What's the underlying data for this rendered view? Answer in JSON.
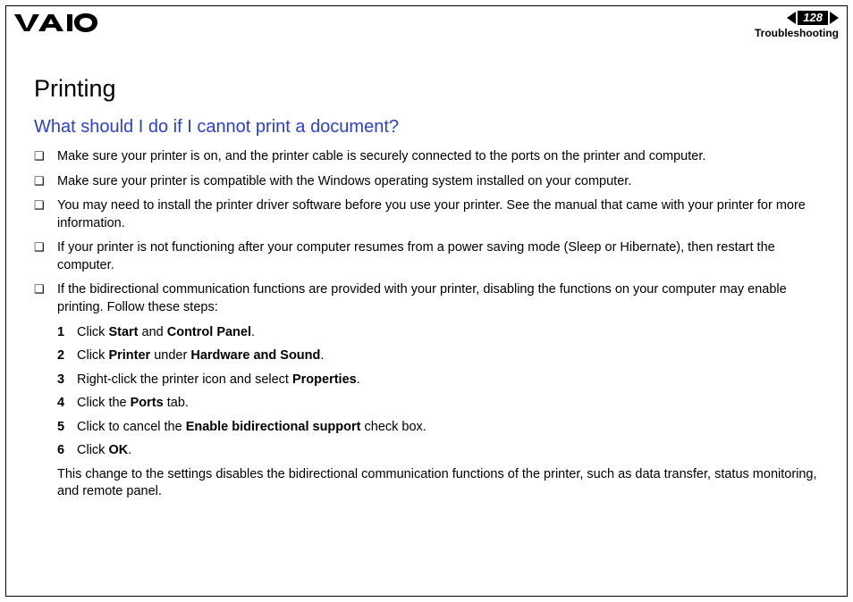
{
  "header": {
    "page_number": "128",
    "section": "Troubleshooting"
  },
  "content": {
    "h1": "Printing",
    "h2": "What should I do if I cannot print a document?",
    "bullets": [
      "Make sure your printer is on, and the printer cable is securely connected to the ports on the printer and computer.",
      "Make sure your printer is compatible with the Windows operating system installed on your computer.",
      "You may need to install the printer driver software before you use your printer. See the manual that came with your printer for more information.",
      "If your printer is not functioning after your computer resumes from a power saving mode (Sleep or Hibernate), then restart the computer.",
      "If the bidirectional communication functions are provided with your printer, disabling the functions on your computer may enable printing. Follow these steps:"
    ],
    "steps": [
      {
        "n": "1",
        "pre": "Click ",
        "b1": "Start",
        "mid": " and ",
        "b2": "Control Panel",
        "post": "."
      },
      {
        "n": "2",
        "pre": "Click ",
        "b1": "Printer",
        "mid": " under ",
        "b2": "Hardware and Sound",
        "post": "."
      },
      {
        "n": "3",
        "pre": "Right-click the printer icon and select ",
        "b1": "Properties",
        "mid": "",
        "b2": "",
        "post": "."
      },
      {
        "n": "4",
        "pre": "Click the ",
        "b1": "Ports",
        "mid": "",
        "b2": "",
        "post": " tab."
      },
      {
        "n": "5",
        "pre": "Click to cancel the ",
        "b1": "Enable bidirectional support",
        "mid": "",
        "b2": "",
        "post": " check box."
      },
      {
        "n": "6",
        "pre": "Click ",
        "b1": "OK",
        "mid": "",
        "b2": "",
        "post": "."
      }
    ],
    "trailing": "This change to the settings disables the bidirectional communication functions of the printer, such as data transfer, status monitoring, and remote panel."
  }
}
